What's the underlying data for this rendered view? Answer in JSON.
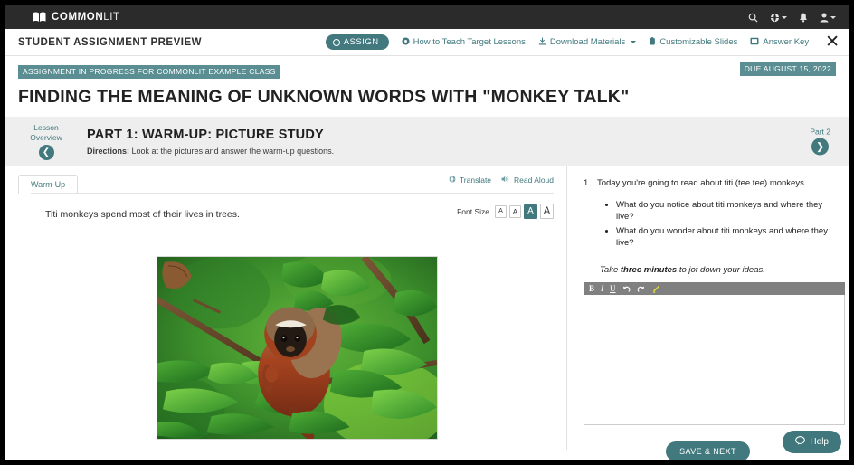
{
  "topbar": {
    "brand_bold": "COMMON",
    "brand_light": "LIT",
    "icons": [
      {
        "name": "search-icon",
        "glyph": "⌕"
      },
      {
        "name": "globe-icon",
        "glyph": "♁"
      },
      {
        "name": "bell-icon",
        "glyph": "ὑ4"
      },
      {
        "name": "user-icon",
        "glyph": "♟"
      }
    ]
  },
  "preview": {
    "title": "STUDENT ASSIGNMENT PREVIEW",
    "assign_label": "ASSIGN",
    "links": [
      {
        "label": "How to Teach Target Lessons",
        "icon": "info-circle-icon",
        "caret": false
      },
      {
        "label": "Download Materials",
        "icon": "download-icon",
        "caret": true
      },
      {
        "label": "Customizable Slides",
        "icon": "clipboard-icon",
        "caret": false
      },
      {
        "label": "Answer Key",
        "icon": "book-icon",
        "caret": false
      }
    ],
    "close_label": "✕"
  },
  "assignment": {
    "status_badge": "ASSIGNMENT IN PROGRESS FOR COMMONLIT EXAMPLE CLASS",
    "due_badge": "DUE AUGUST 15, 2022",
    "title": "FINDING THE MEANING OF UNKNOWN WORDS WITH \"MONKEY TALK\""
  },
  "partbar": {
    "lesson_overview_line1": "Lesson",
    "lesson_overview_line2": "Overview",
    "prev_glyph": "❮",
    "part_title": "PART 1: WARM-UP: PICTURE STUDY",
    "directions_label": "Directions:",
    "directions_text": " Look at the pictures and answer the warm-up questions.",
    "next_label": "Part 2",
    "next_glyph": "❯"
  },
  "left": {
    "tab_label": "Warm-Up",
    "translate_label": "Translate",
    "read_aloud_label": "Read Aloud",
    "font_size_label": "Font Size",
    "font_size_options": [
      "A",
      "A",
      "A",
      "A"
    ],
    "font_size_selected_index": 2,
    "passage_text": "Titi monkeys spend most of their lives in trees.",
    "image_alt": "titi-monkey-in-tree-photo"
  },
  "right": {
    "question_number": "1.",
    "question_text": "Today you're going to read about titi (tee tee) monkeys.",
    "bullets": [
      "What do you notice about titi monkeys and where they live?",
      "What do you wonder about titi monkeys and where they live?"
    ],
    "note_prefix": "Take ",
    "note_bold": "three minutes",
    "note_suffix": " to jot down your ideas.",
    "editor_tools": [
      {
        "name": "bold-icon",
        "label": "B"
      },
      {
        "name": "italic-icon",
        "label": "I"
      },
      {
        "name": "underline-icon",
        "label": "U"
      },
      {
        "name": "undo-icon",
        "label": "↺"
      },
      {
        "name": "redo-icon",
        "label": "↻"
      },
      {
        "name": "highlighter-icon",
        "label": "╱"
      }
    ],
    "editor_value": "",
    "editor_placeholder": "",
    "save_label": "SAVE & NEXT"
  },
  "help": {
    "label": "Help",
    "icon": "chat-bubble-icon"
  },
  "colors": {
    "teal": "#41797e",
    "teal_light": "#5a8e92",
    "dark_header": "#2b2b2b",
    "part_strip": "#eeeeee",
    "editor_toolbar": "#808080",
    "highlighter_yellow": "#e8e432"
  }
}
